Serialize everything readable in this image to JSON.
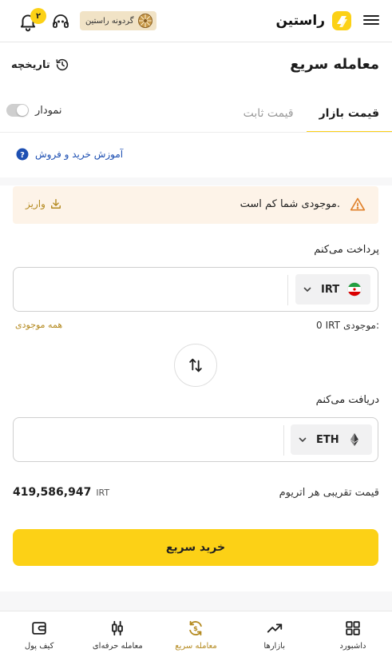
{
  "header": {
    "brand_name": "راستین",
    "wheel_label": "گردونه راستین",
    "notification_count": "۲"
  },
  "page": {
    "title": "معامله سریع",
    "history_label": "تاریخچه"
  },
  "tabs": [
    {
      "label": "قیمت بازار",
      "active": true
    },
    {
      "label": "قیمت ثابت",
      "active": false
    }
  ],
  "chart_toggle_label": "نمودار",
  "tutorial_label": "آموزش خرید و فروش",
  "alert": {
    "message": "موجودی شما کم است.",
    "action_label": "واریز"
  },
  "pay": {
    "label": "پرداخت می‌کنم",
    "amount": "",
    "currency": "IRT",
    "balance_label": "موجودی:",
    "balance_currency": "IRT",
    "balance_value": "0",
    "all_balance_label": "همه موجودی"
  },
  "receive": {
    "label": "دریافت می‌کنم",
    "amount": "",
    "currency": "ETH"
  },
  "rate": {
    "label": "قیمت تقریبی هر اتریوم",
    "value": "419,586,947",
    "currency": "IRT"
  },
  "buy_button_label": "خرید سریع",
  "bottom_nav": [
    {
      "label": "داشبورد",
      "icon": "dashboard-icon",
      "active": false
    },
    {
      "label": "بازارها",
      "icon": "markets-icon",
      "active": false
    },
    {
      "label": "معامله سریع",
      "icon": "quick-trade-icon",
      "active": true
    },
    {
      "label": "معامله حرفه‌ای",
      "icon": "pro-trade-icon",
      "active": false
    },
    {
      "label": "کیف پول",
      "icon": "wallet-icon",
      "active": false
    }
  ],
  "colors": {
    "accent": "#fcd116",
    "accent_text": "#b48a20",
    "link": "#1d4fb2",
    "alert_bg": "#fdf3e8",
    "warning": "#e0812a"
  }
}
